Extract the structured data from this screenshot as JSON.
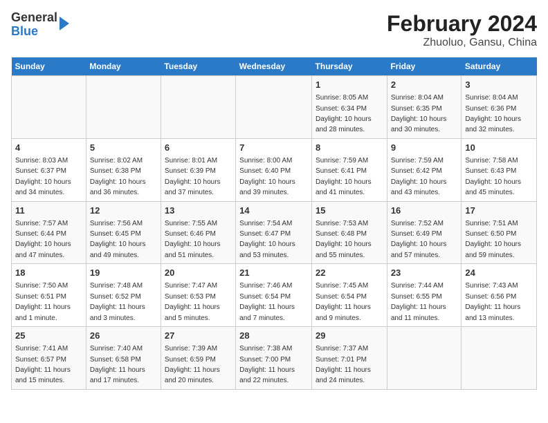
{
  "header": {
    "logo_general": "General",
    "logo_blue": "Blue",
    "title": "February 2024",
    "subtitle": "Zhuoluo, Gansu, China"
  },
  "weekdays": [
    "Sunday",
    "Monday",
    "Tuesday",
    "Wednesday",
    "Thursday",
    "Friday",
    "Saturday"
  ],
  "weeks": [
    [
      {
        "day": "",
        "info": ""
      },
      {
        "day": "",
        "info": ""
      },
      {
        "day": "",
        "info": ""
      },
      {
        "day": "",
        "info": ""
      },
      {
        "day": "1",
        "info": "Sunrise: 8:05 AM\nSunset: 6:34 PM\nDaylight: 10 hours\nand 28 minutes."
      },
      {
        "day": "2",
        "info": "Sunrise: 8:04 AM\nSunset: 6:35 PM\nDaylight: 10 hours\nand 30 minutes."
      },
      {
        "day": "3",
        "info": "Sunrise: 8:04 AM\nSunset: 6:36 PM\nDaylight: 10 hours\nand 32 minutes."
      }
    ],
    [
      {
        "day": "4",
        "info": "Sunrise: 8:03 AM\nSunset: 6:37 PM\nDaylight: 10 hours\nand 34 minutes."
      },
      {
        "day": "5",
        "info": "Sunrise: 8:02 AM\nSunset: 6:38 PM\nDaylight: 10 hours\nand 36 minutes."
      },
      {
        "day": "6",
        "info": "Sunrise: 8:01 AM\nSunset: 6:39 PM\nDaylight: 10 hours\nand 37 minutes."
      },
      {
        "day": "7",
        "info": "Sunrise: 8:00 AM\nSunset: 6:40 PM\nDaylight: 10 hours\nand 39 minutes."
      },
      {
        "day": "8",
        "info": "Sunrise: 7:59 AM\nSunset: 6:41 PM\nDaylight: 10 hours\nand 41 minutes."
      },
      {
        "day": "9",
        "info": "Sunrise: 7:59 AM\nSunset: 6:42 PM\nDaylight: 10 hours\nand 43 minutes."
      },
      {
        "day": "10",
        "info": "Sunrise: 7:58 AM\nSunset: 6:43 PM\nDaylight: 10 hours\nand 45 minutes."
      }
    ],
    [
      {
        "day": "11",
        "info": "Sunrise: 7:57 AM\nSunset: 6:44 PM\nDaylight: 10 hours\nand 47 minutes."
      },
      {
        "day": "12",
        "info": "Sunrise: 7:56 AM\nSunset: 6:45 PM\nDaylight: 10 hours\nand 49 minutes."
      },
      {
        "day": "13",
        "info": "Sunrise: 7:55 AM\nSunset: 6:46 PM\nDaylight: 10 hours\nand 51 minutes."
      },
      {
        "day": "14",
        "info": "Sunrise: 7:54 AM\nSunset: 6:47 PM\nDaylight: 10 hours\nand 53 minutes."
      },
      {
        "day": "15",
        "info": "Sunrise: 7:53 AM\nSunset: 6:48 PM\nDaylight: 10 hours\nand 55 minutes."
      },
      {
        "day": "16",
        "info": "Sunrise: 7:52 AM\nSunset: 6:49 PM\nDaylight: 10 hours\nand 57 minutes."
      },
      {
        "day": "17",
        "info": "Sunrise: 7:51 AM\nSunset: 6:50 PM\nDaylight: 10 hours\nand 59 minutes."
      }
    ],
    [
      {
        "day": "18",
        "info": "Sunrise: 7:50 AM\nSunset: 6:51 PM\nDaylight: 11 hours\nand 1 minute."
      },
      {
        "day": "19",
        "info": "Sunrise: 7:48 AM\nSunset: 6:52 PM\nDaylight: 11 hours\nand 3 minutes."
      },
      {
        "day": "20",
        "info": "Sunrise: 7:47 AM\nSunset: 6:53 PM\nDaylight: 11 hours\nand 5 minutes."
      },
      {
        "day": "21",
        "info": "Sunrise: 7:46 AM\nSunset: 6:54 PM\nDaylight: 11 hours\nand 7 minutes."
      },
      {
        "day": "22",
        "info": "Sunrise: 7:45 AM\nSunset: 6:54 PM\nDaylight: 11 hours\nand 9 minutes."
      },
      {
        "day": "23",
        "info": "Sunrise: 7:44 AM\nSunset: 6:55 PM\nDaylight: 11 hours\nand 11 minutes."
      },
      {
        "day": "24",
        "info": "Sunrise: 7:43 AM\nSunset: 6:56 PM\nDaylight: 11 hours\nand 13 minutes."
      }
    ],
    [
      {
        "day": "25",
        "info": "Sunrise: 7:41 AM\nSunset: 6:57 PM\nDaylight: 11 hours\nand 15 minutes."
      },
      {
        "day": "26",
        "info": "Sunrise: 7:40 AM\nSunset: 6:58 PM\nDaylight: 11 hours\nand 17 minutes."
      },
      {
        "day": "27",
        "info": "Sunrise: 7:39 AM\nSunset: 6:59 PM\nDaylight: 11 hours\nand 20 minutes."
      },
      {
        "day": "28",
        "info": "Sunrise: 7:38 AM\nSunset: 7:00 PM\nDaylight: 11 hours\nand 22 minutes."
      },
      {
        "day": "29",
        "info": "Sunrise: 7:37 AM\nSunset: 7:01 PM\nDaylight: 11 hours\nand 24 minutes."
      },
      {
        "day": "",
        "info": ""
      },
      {
        "day": "",
        "info": ""
      }
    ]
  ]
}
